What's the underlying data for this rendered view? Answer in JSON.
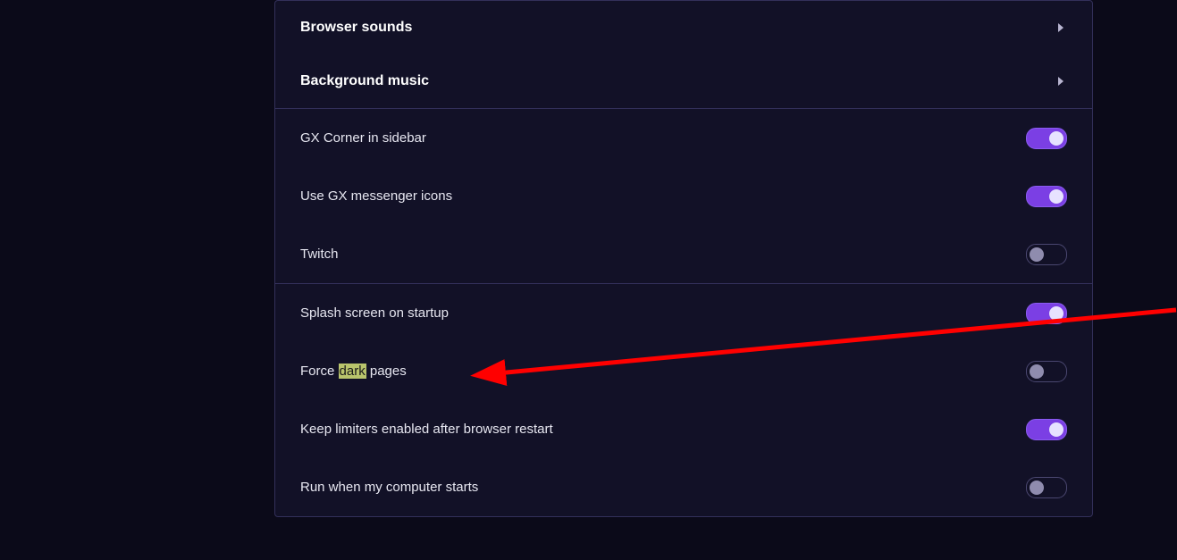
{
  "sections": {
    "expandables": [
      {
        "label": "Browser sounds"
      },
      {
        "label": "Background music"
      }
    ]
  },
  "group1": [
    {
      "label": "GX Corner in sidebar",
      "on": true
    },
    {
      "label": "Use GX messenger icons",
      "on": true
    },
    {
      "label": "Twitch",
      "on": false
    }
  ],
  "group2": [
    {
      "label_pre": "Splash screen on startup",
      "on": true,
      "highlight": null,
      "label_post": ""
    },
    {
      "label_pre": "Force ",
      "highlight": "dark",
      "label_post": " pages",
      "on": false
    },
    {
      "label_pre": "Keep limiters enabled after browser restart",
      "on": true,
      "highlight": null,
      "label_post": ""
    },
    {
      "label_pre": "Run when my computer starts",
      "on": false,
      "highlight": null,
      "label_post": ""
    }
  ],
  "annotation": {
    "type": "arrow",
    "color": "#ff0000"
  }
}
